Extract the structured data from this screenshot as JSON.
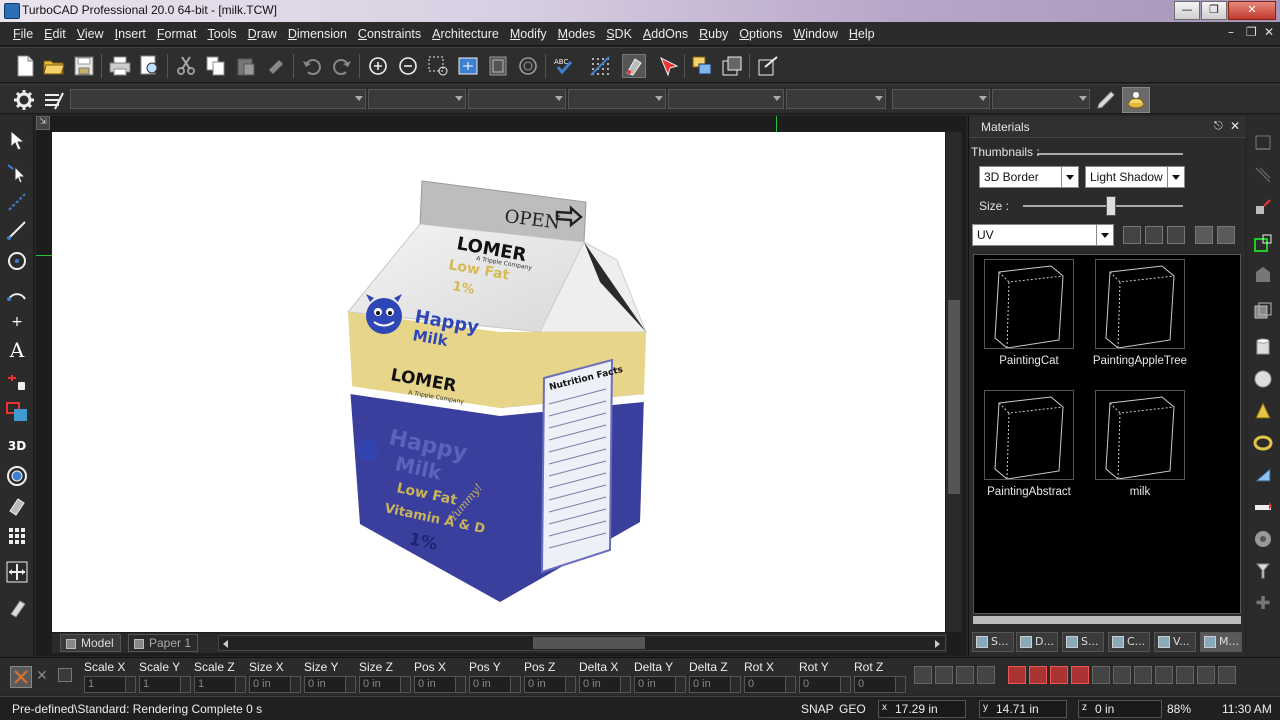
{
  "window": {
    "title": "TurboCAD Professional 20.0 64-bit - [milk.TCW]",
    "controls": [
      "minimize-icon",
      "restore-icon",
      "close-icon"
    ],
    "mdi_controls": [
      "minimize-icon",
      "restore-icon",
      "close-icon"
    ]
  },
  "menu": {
    "items": [
      "File",
      "Edit",
      "View",
      "Insert",
      "Format",
      "Tools",
      "Draw",
      "Dimension",
      "Constraints",
      "Architecture",
      "Modify",
      "Modes",
      "SDK",
      "AddOns",
      "Ruby",
      "Options",
      "Window",
      "Help"
    ]
  },
  "toolbar1": {
    "icons": [
      "new-file-icon",
      "open-folder-icon",
      "save-icon",
      "print-icon",
      "print-preview-icon",
      "cut-icon",
      "copy-icon",
      "paste-icon",
      "format-painter-icon",
      "undo-icon",
      "redo-icon",
      "zoom-in-icon",
      "zoom-out-icon",
      "zoom-window-icon",
      "zoom-extents-icon",
      "zoom-page-icon",
      "zoom-previous-icon",
      "spell-check-icon",
      "grid-icon",
      "snap-icon",
      "select-filter-icon",
      "layers-icon",
      "design-director-icon",
      "properties-icon"
    ]
  },
  "toolbar2": {
    "icons": [
      "settings-gear-icon",
      "format-toolbar-icon",
      "pen-icon",
      "render-icon"
    ],
    "combo_count": 10
  },
  "left_palette": {
    "icons": [
      "select-arrow-icon",
      "node-edit-icon",
      "point-line-icon",
      "line-icon",
      "circle-icon",
      "arc-icon",
      "point-icon",
      "text-icon",
      "dimension-icon",
      "rectangle-icon",
      "3d-tools-icon",
      "3d-object-icon",
      "modify-icon",
      "hatch-grid-icon",
      "move-copy-icon",
      "eraser-icon"
    ]
  },
  "drawing": {
    "sheet_tabs": [
      "Model",
      "Paper 1"
    ],
    "carton": {
      "top_tab": "OPEN",
      "brand": "LOMER",
      "brand_sub": "A Tripple Company",
      "variant": "Low Fat",
      "percent": "1%",
      "product_name_line1": "Happy",
      "product_name_line2": "Milk",
      "vitamins": "Vitamin A & D",
      "nutrition_title": "Nutrition Facts",
      "slogan": "Yummy!"
    }
  },
  "materials_panel": {
    "title": "Materials",
    "thumbnails_label": "Thumbnails :",
    "border_select": "3D Border",
    "shadow_select": "Light Shadow",
    "size_label": "Size :",
    "size_value": 0.55,
    "mapping_select": "UV",
    "panel_icons": [
      "new-material-icon",
      "material-library-icon",
      "material-pin-icon",
      "material-view-icon",
      "material-tools-icon"
    ],
    "materials": [
      {
        "name": "PaintingCat"
      },
      {
        "name": "PaintingAppleTree"
      },
      {
        "name": "PaintingAbstract"
      },
      {
        "name": "milk"
      }
    ],
    "tabs": [
      "S...",
      "D...",
      "S...",
      "C...",
      "V...",
      "M..."
    ]
  },
  "right_strip": {
    "icons": [
      "extrude-icon",
      "revolve-icon",
      "sweep-icon",
      "loft-icon",
      "shell-icon",
      "box-icon",
      "cylinder-icon",
      "sphere-icon",
      "cone-icon",
      "torus-icon",
      "wedge-icon",
      "boolean-icon",
      "chamfer-icon",
      "fillet-icon",
      "slice-icon",
      "plus-icon"
    ]
  },
  "inspector": {
    "fields": [
      {
        "label": "Scale X",
        "value": "1"
      },
      {
        "label": "Scale Y",
        "value": "1"
      },
      {
        "label": "Scale Z",
        "value": "1"
      },
      {
        "label": "Size X",
        "value": "0 in"
      },
      {
        "label": "Size Y",
        "value": "0 in"
      },
      {
        "label": "Size Z",
        "value": "0 in"
      },
      {
        "label": "Pos X",
        "value": "0 in"
      },
      {
        "label": "Pos Y",
        "value": "0 in"
      },
      {
        "label": "Pos Z",
        "value": "0 in"
      },
      {
        "label": "Delta X",
        "value": "0 in"
      },
      {
        "label": "Delta Y",
        "value": "0 in"
      },
      {
        "label": "Delta Z",
        "value": "0 in"
      },
      {
        "label": "Rot X",
        "value": "0"
      },
      {
        "label": "Rot Y",
        "value": "0"
      },
      {
        "label": "Rot Z",
        "value": "0"
      }
    ]
  },
  "status": {
    "message": "Pre-defined\\Standard: Rendering Complete 0 s",
    "snap": "SNAP",
    "geo": "GEO",
    "x": "17.29 in",
    "y": "14.71 in",
    "z": "0 in",
    "zoom": "88%",
    "time": "11:30 AM"
  },
  "colors": {
    "carton_blue": "#3a3f9e",
    "carton_yellow": "#e7d68a",
    "accent_blue": "#2f47b6"
  }
}
